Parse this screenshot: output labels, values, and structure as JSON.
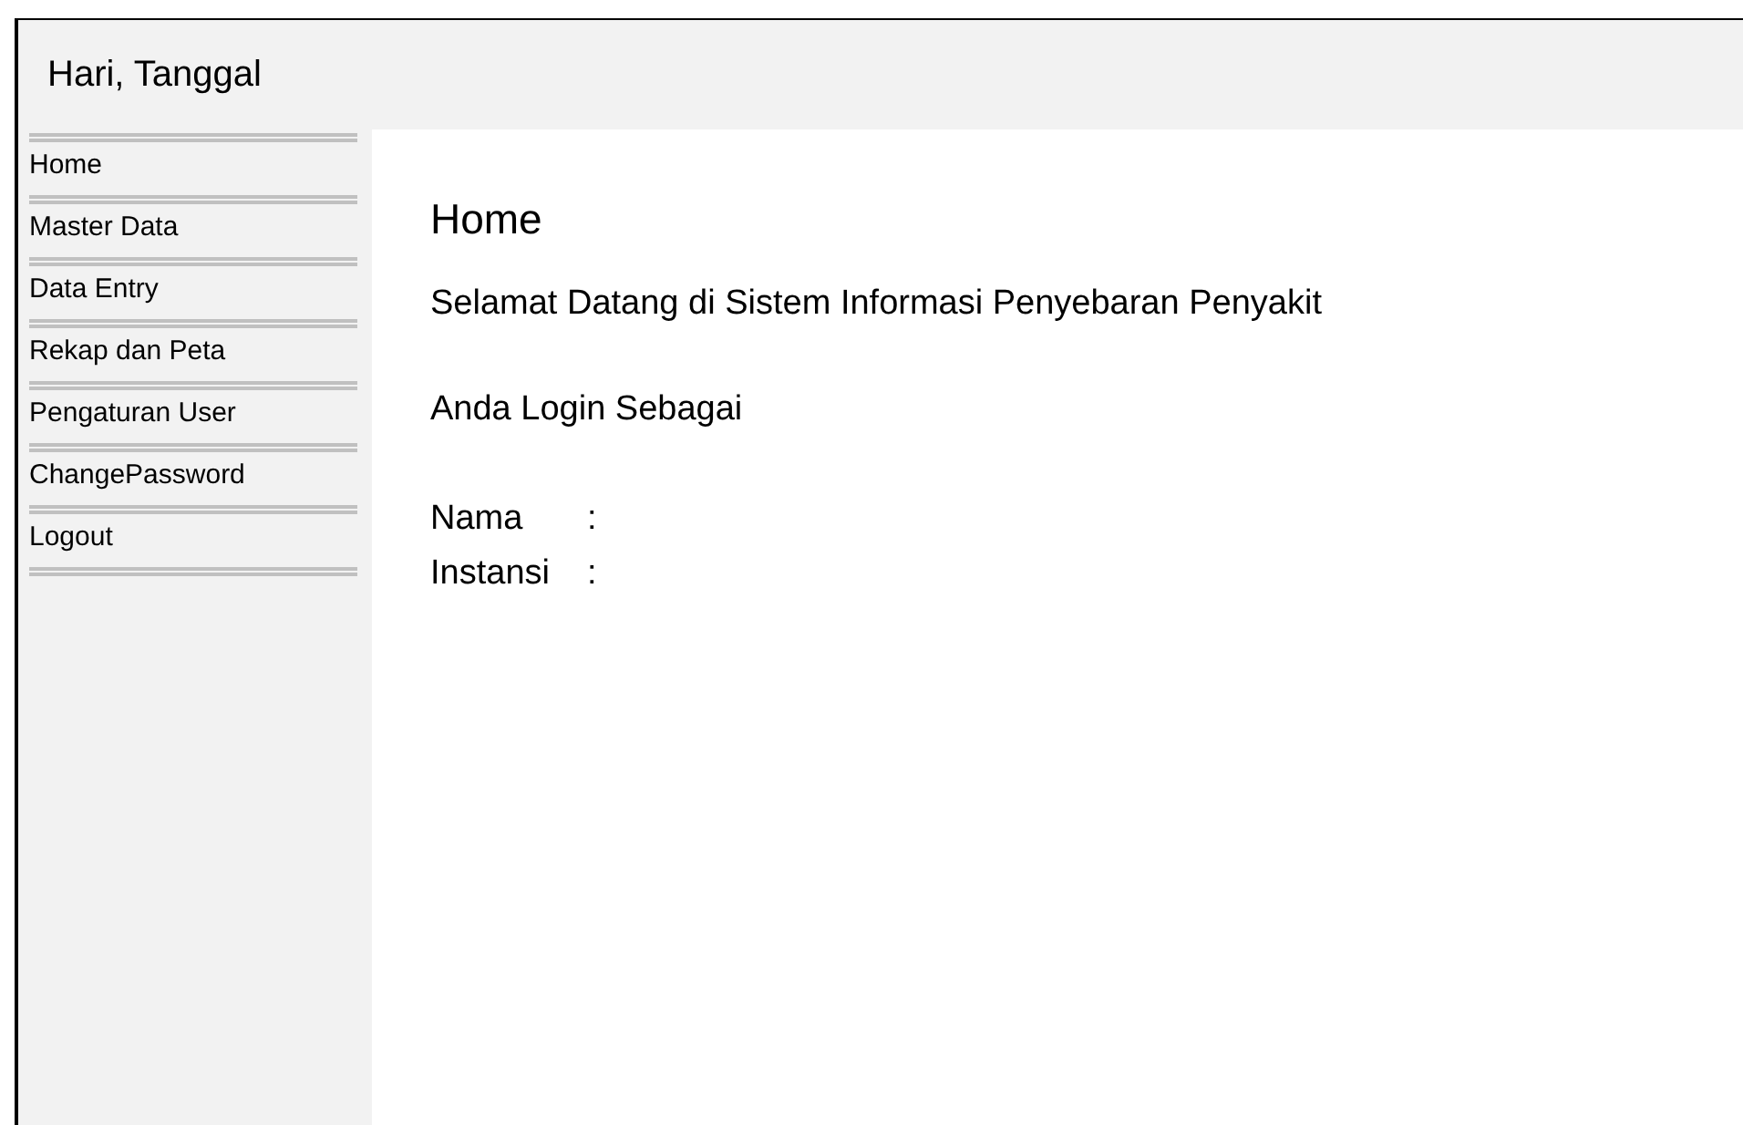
{
  "header": {
    "title": "Hari, Tanggal"
  },
  "sidebar": {
    "items": [
      {
        "label": "Home"
      },
      {
        "label": "Master Data"
      },
      {
        "label": "Data Entry"
      },
      {
        "label": "Rekap dan Peta"
      },
      {
        "label": "Pengaturan User"
      },
      {
        "label": "ChangePassword"
      },
      {
        "label": "Logout"
      }
    ]
  },
  "content": {
    "heading": "Home",
    "welcome": "Selamat Datang di Sistem Informasi Penyebaran Penyakit",
    "login_note": "Anda Login Sebagai",
    "fields": [
      {
        "label": "Nama",
        "separator": ":"
      },
      {
        "label": "Instansi",
        "separator": ":"
      }
    ]
  }
}
